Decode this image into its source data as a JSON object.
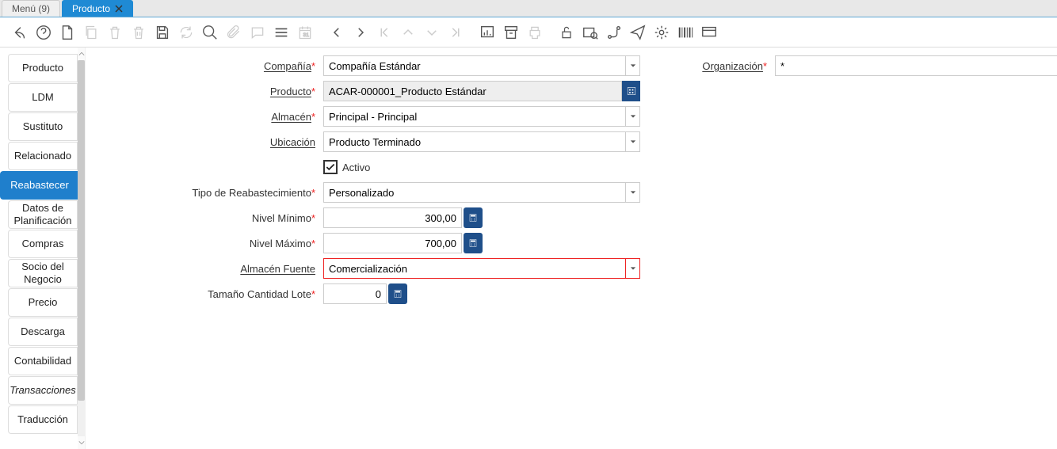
{
  "tabs": {
    "menu": "Menú (9)",
    "product": "Producto"
  },
  "sidebar": {
    "items": [
      {
        "label": "Producto"
      },
      {
        "label": "LDM"
      },
      {
        "label": "Sustituto"
      },
      {
        "label": "Relacionado"
      },
      {
        "label": "Reabastecer"
      },
      {
        "label": "Datos de Planificación"
      },
      {
        "label": "Compras"
      },
      {
        "label": "Socio del Negocio"
      },
      {
        "label": "Precio"
      },
      {
        "label": "Descarga"
      },
      {
        "label": "Contabilidad"
      },
      {
        "label": "Transacciones",
        "italic": true
      },
      {
        "label": "Traducción"
      }
    ],
    "active": 4
  },
  "form": {
    "compania": {
      "label": "Compañía",
      "value": "Compañía Estándar"
    },
    "org": {
      "label": "Organización",
      "value": "*"
    },
    "producto": {
      "label": "Producto",
      "value": "ACAR-000001_Producto Estándar"
    },
    "almacen": {
      "label": "Almacén",
      "value": "Principal - Principal"
    },
    "ubicacion": {
      "label": "Ubicación",
      "value": "Producto Terminado"
    },
    "activo": {
      "label": "Activo",
      "checked": true
    },
    "tipo": {
      "label": "Tipo de Reabastecimiento",
      "value": "Personalizado"
    },
    "nmin": {
      "label": "Nivel Mínimo",
      "value": "300,00"
    },
    "nmax": {
      "label": "Nivel Máximo",
      "value": "700,00"
    },
    "almfuente": {
      "label": "Almacén Fuente",
      "value": "Comercialización"
    },
    "lote": {
      "label": "Tamaño Cantidad Lote",
      "value": "0"
    }
  }
}
